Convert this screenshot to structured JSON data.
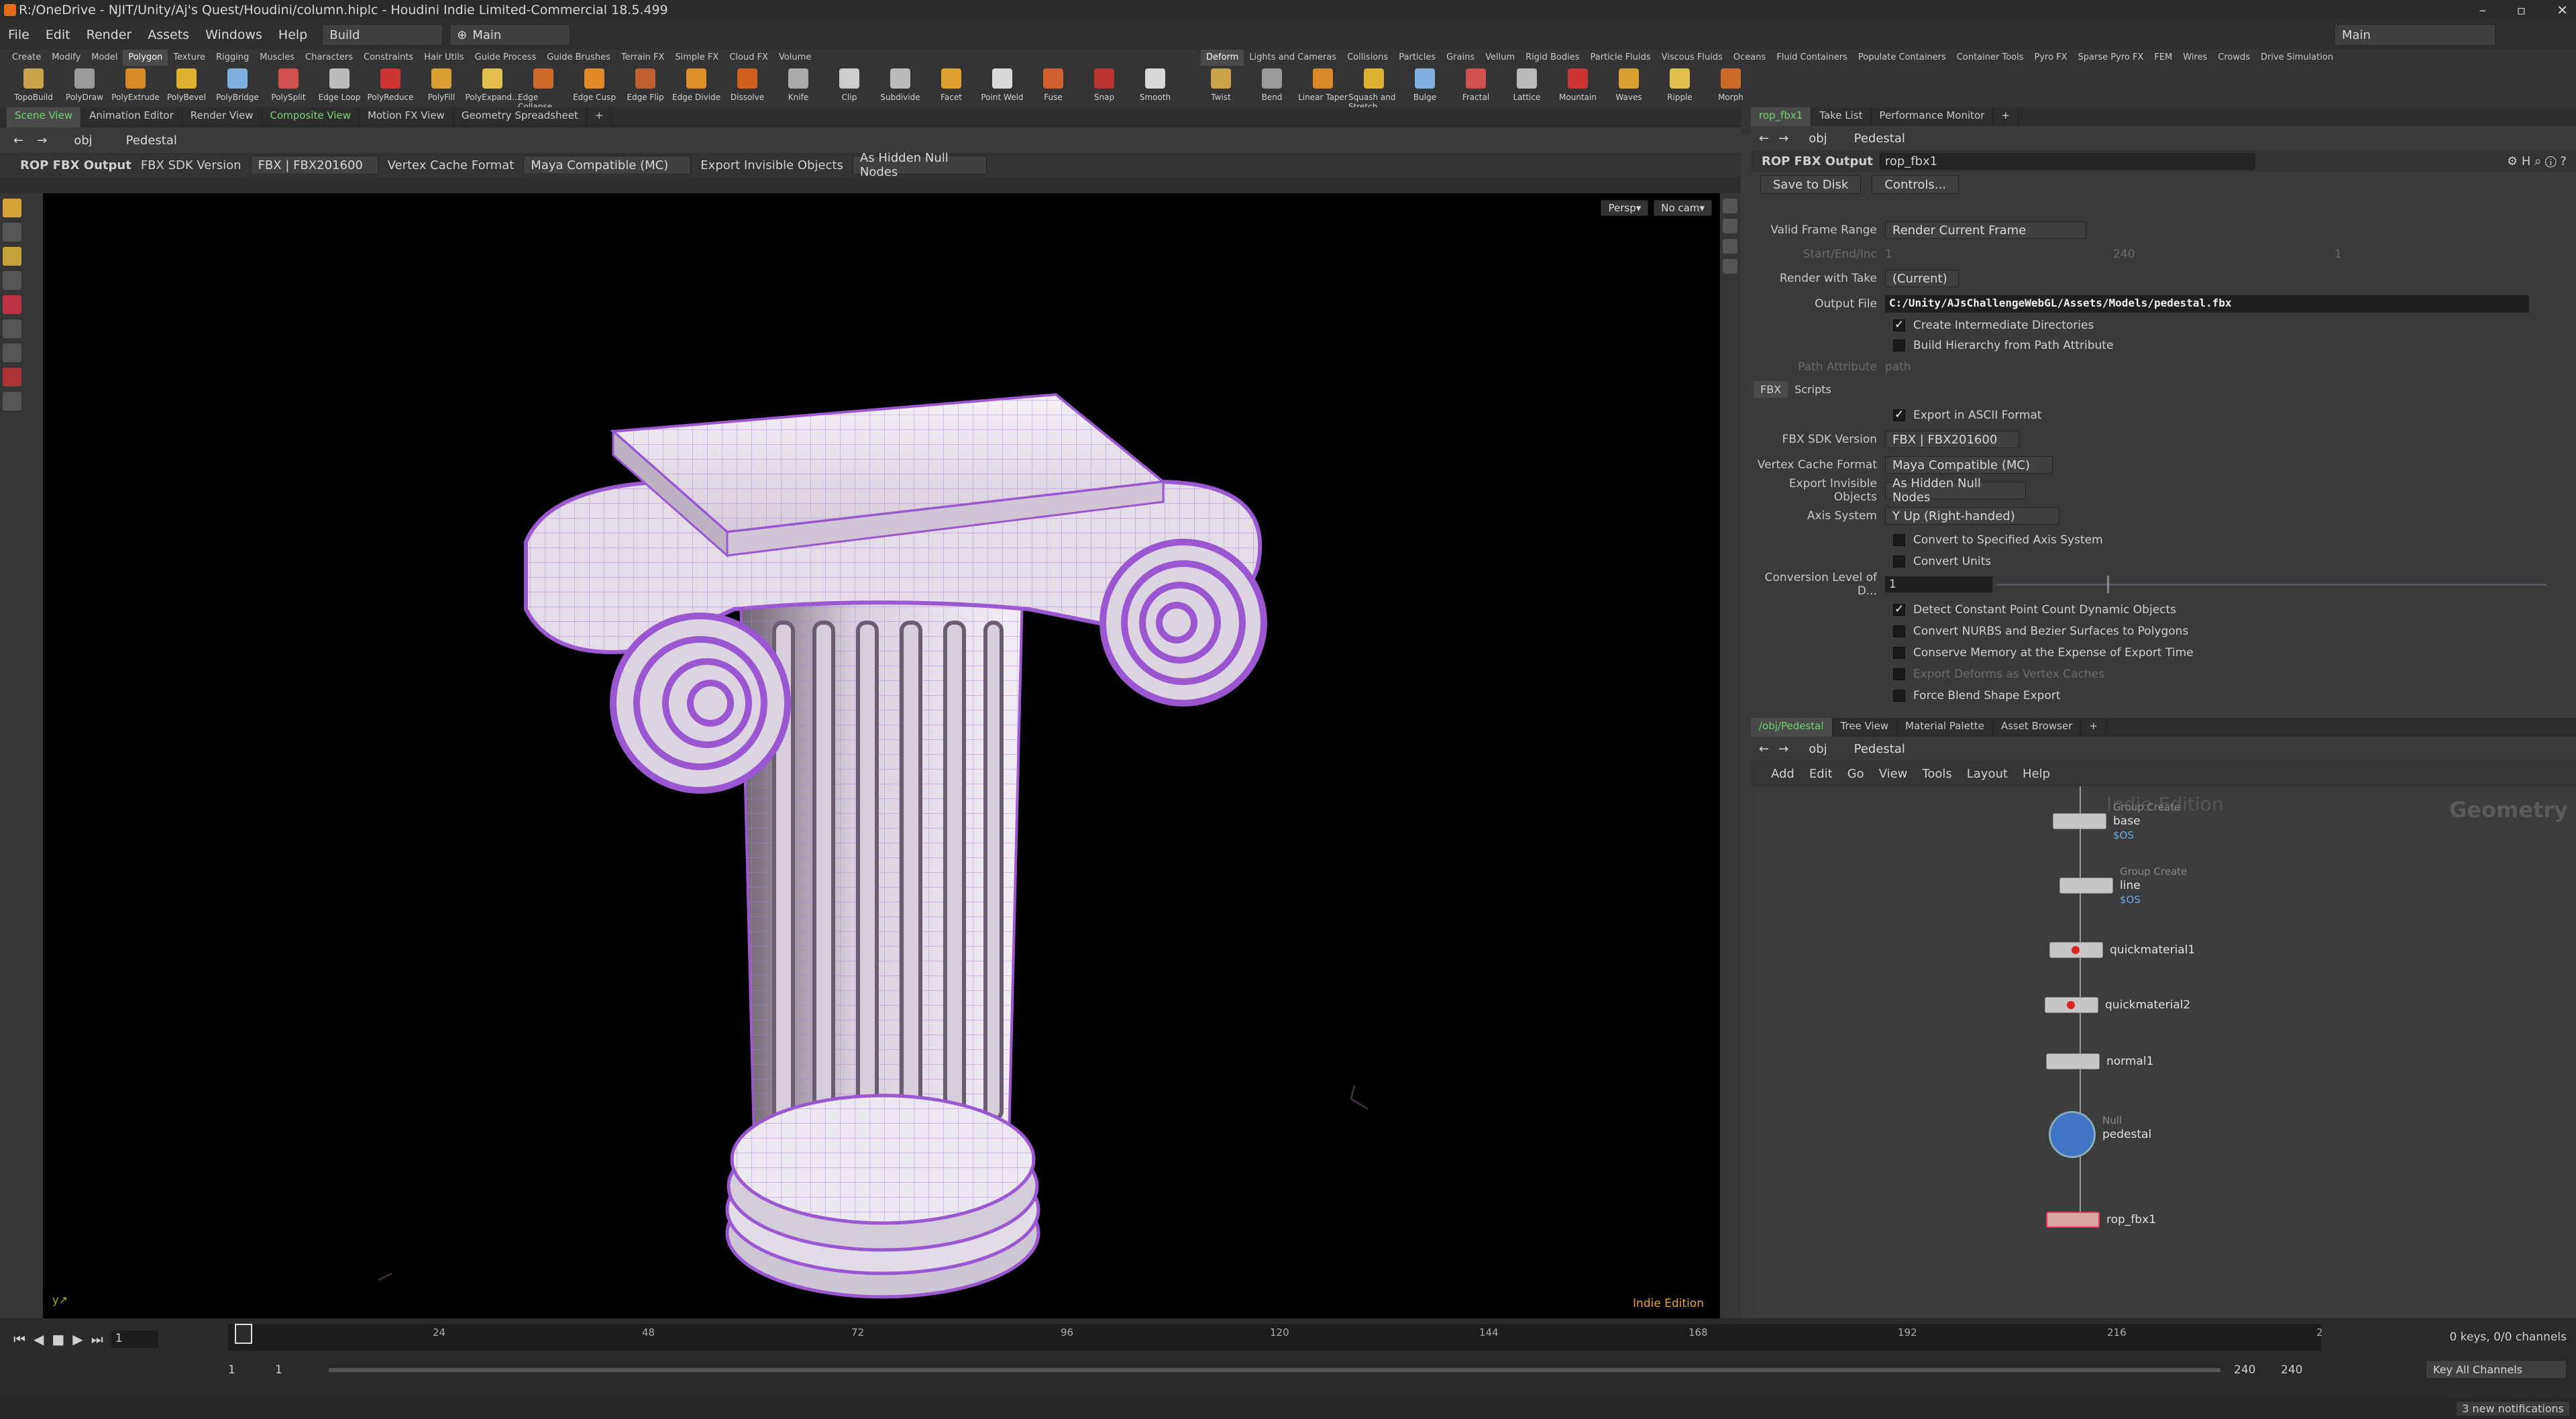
{
  "window": {
    "title": "R:/OneDrive - NJIT/Unity/Aj's Quest/Houdini/column.hiplc - Houdini Indie Limited-Commercial 18.5.499"
  },
  "menu": {
    "items": [
      "File",
      "Edit",
      "Render",
      "Assets",
      "Windows",
      "Help"
    ],
    "desktop": "Build",
    "context": "Main",
    "right_desktop": "Main"
  },
  "shelf": {
    "left_tabs": [
      "Create",
      "Modify",
      "Model",
      "Polygon",
      "Texture",
      "Rigging",
      "Muscles",
      "Characters",
      "Constraints",
      "Hair Utils",
      "Guide Process",
      "Guide Brushes",
      "Terrain FX",
      "Simple FX",
      "Cloud FX",
      "Volume"
    ],
    "left_active": "Polygon",
    "left_tools": [
      "TopoBuild",
      "PolyDraw",
      "PolyExtrude",
      "PolyBevel",
      "PolyBridge",
      "PolySplit",
      "Edge Loop",
      "PolyReduce",
      "PolyFill",
      "PolyExpand...",
      "Edge Collapse",
      "Edge Cusp",
      "Edge Flip",
      "Edge Divide",
      "Dissolve",
      "Knife",
      "Clip",
      "Subdivide",
      "Facet",
      "Point Weld",
      "Fuse",
      "Snap",
      "Smooth"
    ],
    "right_tabs": [
      "Deform",
      "Lights and Cameras",
      "Collisions",
      "Particles",
      "Grains",
      "Vellum",
      "Rigid Bodies",
      "Particle Fluids",
      "Viscous Fluids",
      "Oceans",
      "Fluid Containers",
      "Populate Containers",
      "Container Tools",
      "Pyro FX",
      "Sparse Pyro FX",
      "FEM",
      "Wires",
      "Crowds",
      "Drive Simulation"
    ],
    "right_active": "Deform",
    "right_tools": [
      "Twist",
      "Bend",
      "Linear Taper",
      "Squash and Stretch",
      "Bulge",
      "Fractal",
      "Lattice",
      "Mountain",
      "Waves",
      "Ripple",
      "Morph"
    ]
  },
  "scene_pane": {
    "tabs": [
      "Scene View",
      "Animation Editor",
      "Render View",
      "Composite View",
      "Motion FX View",
      "Geometry Spreadsheet"
    ],
    "active": "Scene View",
    "path": [
      "obj",
      "Pedestal"
    ],
    "toolbar": {
      "node": "ROP FBX Output",
      "fbx_sdk_label": "FBX SDK Version",
      "fbx_sdk_value": "FBX | FBX201600",
      "vertex_cache_label": "Vertex Cache Format",
      "vertex_cache_value": "Maya Compatible (MC)",
      "export_invisible_label": "Export Invisible Objects",
      "export_invisible_value": "As Hidden Null Nodes"
    },
    "view": {
      "persp": "Persp",
      "cam": "No cam"
    },
    "watermark": "Indie Edition"
  },
  "param_pane": {
    "tabs": [
      "rop_fbx1",
      "Take List",
      "Performance Monitor"
    ],
    "path": [
      "obj",
      "Pedestal"
    ],
    "node_type": "ROP FBX Output",
    "node_name": "rop_fbx1",
    "buttons": {
      "save": "Save to Disk",
      "controls": "Controls..."
    },
    "valid_frame_range_label": "Valid Frame Range",
    "valid_frame_range": "Render Current Frame",
    "start_end_label": "Start/End/Inc",
    "start": "1",
    "end": "240",
    "inc": "1",
    "render_take_label": "Render with Take",
    "render_take": "(Current)",
    "output_file_label": "Output File",
    "output_file": "C:/Unity/AJsChallengeWebGL/Assets/Models/pedestal.fbx",
    "create_dirs": "Create Intermediate Directories",
    "build_hierarchy": "Build Hierarchy from Path Attribute",
    "path_attr_label": "Path Attribute",
    "path_attr": "path",
    "sub_tabs": [
      "FBX",
      "Scripts"
    ],
    "ascii": "Export in ASCII Format",
    "sdk_label": "FBX SDK Version",
    "sdk": "FBX | FBX201600",
    "vcf_label": "Vertex Cache Format",
    "vcf": "Maya Compatible (MC)",
    "eio_label": "Export Invisible Objects",
    "eio": "As Hidden Null Nodes",
    "axis_label": "Axis System",
    "axis": "Y Up (Right-handed)",
    "convert_axis": "Convert to Specified Axis System",
    "convert_units": "Convert Units",
    "lod_label": "Conversion Level of D...",
    "lod": "1",
    "detect": "Detect Constant Point Count Dynamic Objects",
    "nurbs": "Convert NURBS and Bezier Surfaces to Polygons",
    "conserve": "Conserve Memory at the Expense of Export Time",
    "deforms": "Export Deforms as Vertex Caches",
    "blend": "Force Blend Shape Export"
  },
  "network_pane": {
    "tabs": [
      "/obj/Pedestal",
      "Tree View",
      "Material Palette",
      "Asset Browser"
    ],
    "path": [
      "obj",
      "Pedestal"
    ],
    "menu": [
      "Add",
      "Edit",
      "Go",
      "View",
      "Tools",
      "Layout",
      "Help"
    ],
    "watermark": "Indie Edition",
    "context": "Geometry",
    "nodes": [
      {
        "type": "Group Create",
        "name": "base",
        "expr": "$OS"
      },
      {
        "type": "Group Create",
        "name": "line",
        "expr": "$OS"
      },
      {
        "type": "",
        "name": "quickmaterial1",
        "expr": ""
      },
      {
        "type": "",
        "name": "quickmaterial2",
        "expr": ""
      },
      {
        "type": "",
        "name": "normal1",
        "expr": ""
      },
      {
        "type": "Null",
        "name": "pedestal",
        "expr": ""
      },
      {
        "type": "",
        "name": "rop_fbx1",
        "expr": ""
      }
    ]
  },
  "timeline": {
    "frame": "1",
    "ticks": [
      "24",
      "48",
      "72",
      "96",
      "120",
      "144",
      "168",
      "192",
      "216",
      "2"
    ],
    "start": "1",
    "start2": "1",
    "end": "240",
    "end2": "240",
    "keys": "0 keys, 0/0 channels",
    "key_all": "Key All Channels",
    "notifications": "3 new notifications"
  }
}
